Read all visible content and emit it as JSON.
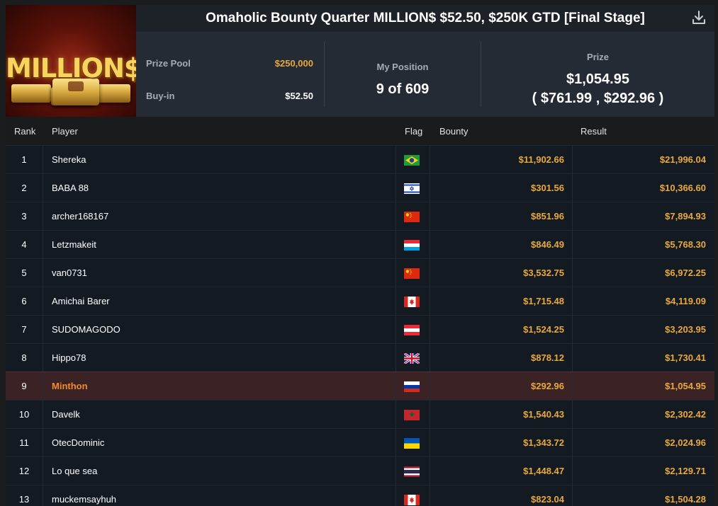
{
  "tournament": {
    "title": "Omaholic Bounty Quarter MILLION$ $52.50, $250K GTD [Final Stage]",
    "logo_text": "MILLION$"
  },
  "stats": {
    "prize_pool_label": "Prize Pool",
    "prize_pool_value": "$250,000",
    "buyin_label": "Buy-in",
    "buyin_value": "$52.50",
    "position_label": "My Position",
    "position_value": "9 of 609",
    "prize_label": "Prize",
    "prize_total": "$1,054.95",
    "prize_breakdown": "( $761.99 , $292.96 )"
  },
  "table": {
    "headers": {
      "rank": "Rank",
      "player": "Player",
      "flag": "Flag",
      "bounty": "Bounty",
      "result": "Result"
    },
    "rows": [
      {
        "rank": "1",
        "player": "Shereka",
        "flag": "brazil-flag-icon",
        "bounty": "$11,902.66",
        "result": "$21,996.04"
      },
      {
        "rank": "2",
        "player": "BABA 88",
        "flag": "israel-flag-icon",
        "bounty": "$301.56",
        "result": "$10,366.60"
      },
      {
        "rank": "3",
        "player": "archer168167",
        "flag": "china-flag-icon",
        "bounty": "$851.96",
        "result": "$7,894.93"
      },
      {
        "rank": "4",
        "player": "Letzmakeit",
        "flag": "luxembourg-flag-icon",
        "bounty": "$846.49",
        "result": "$5,768.30"
      },
      {
        "rank": "5",
        "player": "van0731",
        "flag": "china-flag-icon",
        "bounty": "$3,532.75",
        "result": "$6,972.25"
      },
      {
        "rank": "6",
        "player": "Amichai Barer",
        "flag": "canada-flag-icon",
        "bounty": "$1,715.48",
        "result": "$4,119.09"
      },
      {
        "rank": "7",
        "player": "SUDOMAGODO",
        "flag": "austria-flag-icon",
        "bounty": "$1,524.25",
        "result": "$3,203.95"
      },
      {
        "rank": "8",
        "player": "Hippo78",
        "flag": "uk-flag-icon",
        "bounty": "$878.12",
        "result": "$1,730.41"
      },
      {
        "rank": "9",
        "player": "Minthon",
        "flag": "russia-flag-icon",
        "bounty": "$292.96",
        "result": "$1,054.95",
        "highlight": true
      },
      {
        "rank": "10",
        "player": "Davelk",
        "flag": "morocco-flag-icon",
        "bounty": "$1,540.43",
        "result": "$2,302.42"
      },
      {
        "rank": "11",
        "player": "OtecDominic",
        "flag": "ukraine-flag-icon",
        "bounty": "$1,343.72",
        "result": "$2,024.96"
      },
      {
        "rank": "12",
        "player": "Lo que sea",
        "flag": "thailand-flag-icon",
        "bounty": "$1,448.47",
        "result": "$2,129.71"
      },
      {
        "rank": "13",
        "player": "muckemsayhuh",
        "flag": "canada-flag-icon",
        "bounty": "$823.04",
        "result": "$1,504.28"
      }
    ]
  },
  "colors": {
    "accent": "#e8a93e",
    "highlight_row": "#3b2224",
    "highlight_name": "#f28c2a"
  }
}
